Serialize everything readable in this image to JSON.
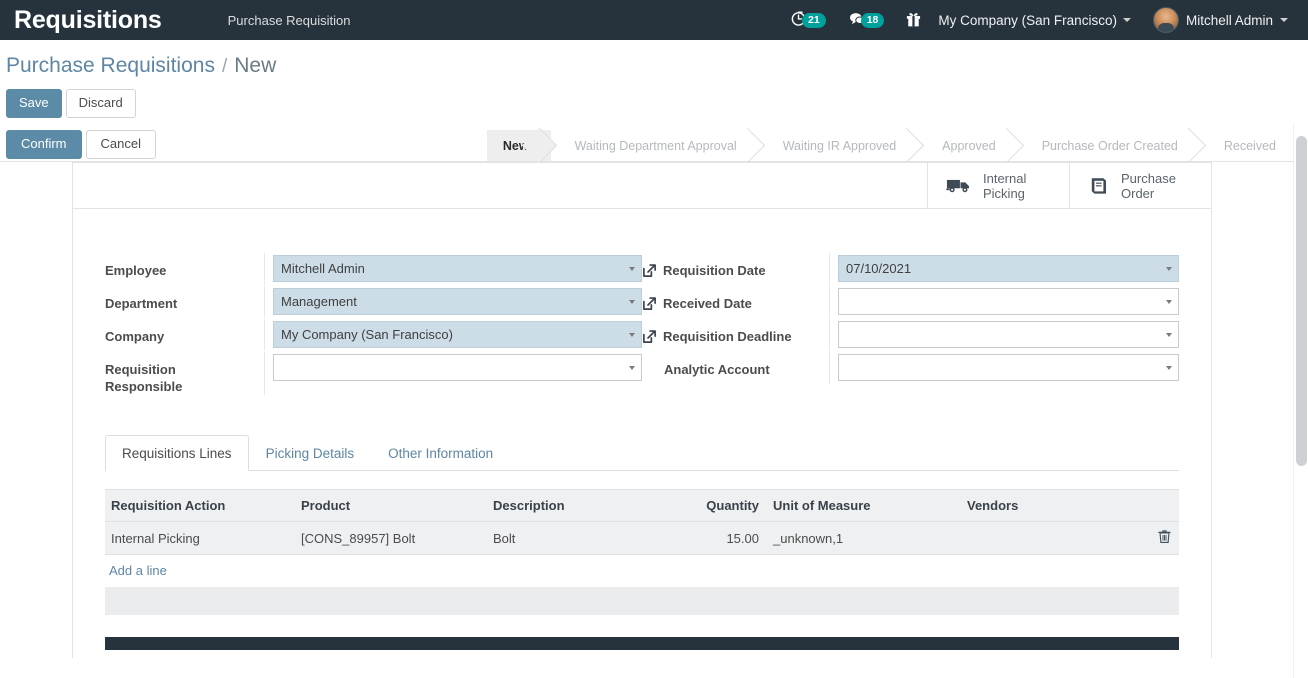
{
  "navbar": {
    "brand": "Requisitions",
    "menu_item": "Purchase Requisition",
    "activity_icon": "clock-icon",
    "activity_count": "21",
    "messages_icon": "chat-icon",
    "messages_count": "18",
    "gift_icon": "gift-icon",
    "company": "My Company (San Francisco)",
    "user": "Mitchell Admin",
    "background": "#26333d",
    "badge_color": "#00a09d"
  },
  "breadcrumb": {
    "parent": "Purchase Requisitions",
    "separator": "/",
    "current": "New"
  },
  "actions": {
    "save": "Save",
    "discard": "Discard",
    "confirm": "Confirm",
    "cancel": "Cancel",
    "primary_color": "#5c8ba8"
  },
  "statusbar": {
    "stages": [
      {
        "label": "New",
        "active": true
      },
      {
        "label": "Waiting Department Approval",
        "active": false
      },
      {
        "label": "Waiting IR Approved",
        "active": false
      },
      {
        "label": "Approved",
        "active": false
      },
      {
        "label": "Purchase Order Created",
        "active": false
      },
      {
        "label": "Received",
        "active": false
      }
    ]
  },
  "button_box": [
    {
      "icon": "truck-icon",
      "line1": "Internal",
      "line2": "Picking"
    },
    {
      "icon": "book-icon",
      "line1": "Purchase",
      "line2": "Order"
    }
  ],
  "form": {
    "left": [
      {
        "label": "Employee",
        "value": "Mitchell Admin",
        "filled": true,
        "ext": false
      },
      {
        "label": "Department",
        "value": "Management",
        "filled": true,
        "ext": false
      },
      {
        "label": "Company",
        "value": "My Company (San Francisco)",
        "filled": true,
        "ext": false
      },
      {
        "label": "Requisition Responsible",
        "value": "",
        "filled": false,
        "ext": false
      }
    ],
    "right": [
      {
        "label": "Requisition Date",
        "value": "07/10/2021",
        "filled": true,
        "ext": true
      },
      {
        "label": "Received Date",
        "value": "",
        "filled": false,
        "ext": true
      },
      {
        "label": "Requisition Deadline",
        "value": "",
        "filled": false,
        "ext": true
      },
      {
        "label": "Analytic Account",
        "value": "",
        "filled": false,
        "ext": false
      }
    ]
  },
  "notebook": {
    "tabs": [
      {
        "label": "Requisitions Lines",
        "active": true
      },
      {
        "label": "Picking Details",
        "active": false
      },
      {
        "label": "Other Information",
        "active": false
      }
    ]
  },
  "lines_table": {
    "headers": [
      "Requisition Action",
      "Product",
      "Description",
      "Quantity",
      "Unit of Measure",
      "Vendors",
      ""
    ],
    "rows": [
      {
        "action": "Internal Picking",
        "product": "[CONS_89957] Bolt",
        "description": "Bolt",
        "quantity": "15.00",
        "uom": "_unknown,1",
        "vendors": "",
        "delete_icon": "trash-icon"
      }
    ],
    "add_line": "Add a line"
  }
}
